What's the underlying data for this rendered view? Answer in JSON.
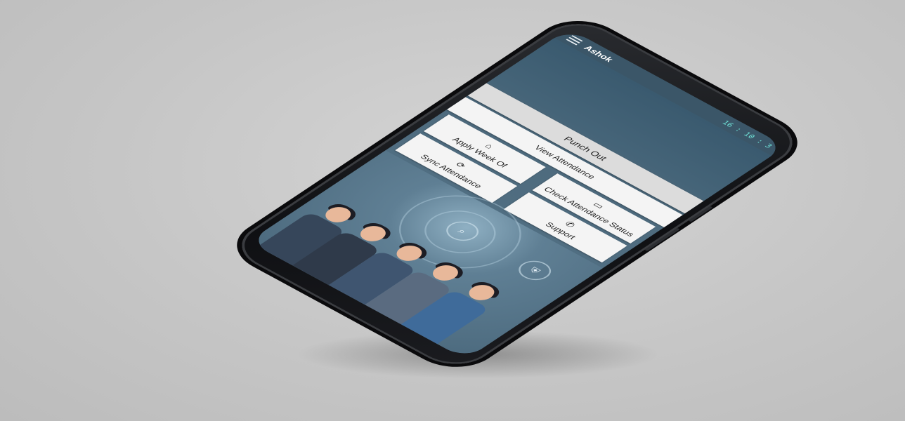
{
  "header": {
    "user_name": "Ashok",
    "clock": "16 : 10 : 3"
  },
  "actions": {
    "punch_out": "Punch Out",
    "view_attendance": "View Attendance",
    "apply_week_off": "Apply Week Of",
    "check_attendance_status": "Check Attendance Status",
    "sync_attendance": "Sync Attendance",
    "support": "Support"
  },
  "icons": {
    "menu": "hamburger-icon",
    "apply_week_off": "home-icon",
    "check_attendance_status": "tablet-icon",
    "sync_attendance": "sync-icon",
    "support": "phone-icon",
    "security": "lock-icon",
    "search": "search-icon"
  },
  "colors": {
    "background": "#c6c6c6",
    "status_bar": "#3b5668",
    "clock_text": "#6fe0d6",
    "tile": "#f4f4f4",
    "punch_tile": "#dcdcdc"
  }
}
